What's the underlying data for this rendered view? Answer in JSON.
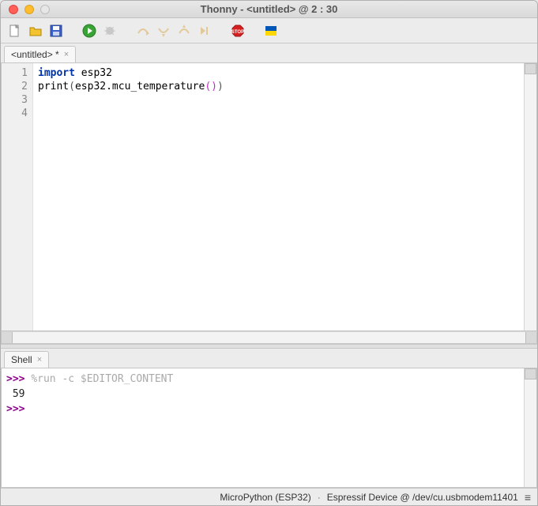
{
  "window": {
    "title": "Thonny  -  <untitled>  @  2 : 30"
  },
  "traffic": {
    "close": "close",
    "minimize": "minimize",
    "zoom": "zoom"
  },
  "toolbar": {
    "new": "new-file-icon",
    "open": "open-file-icon",
    "save": "save-icon",
    "run": "run-icon",
    "debug": "debug-icon",
    "step_over": "step-over-icon",
    "step_into": "step-into-icon",
    "step_out": "step-out-icon",
    "resume": "resume-icon",
    "stop": "stop-icon",
    "flag": "flag-icon"
  },
  "editor": {
    "tab_label": "<untitled> *",
    "line_numbers": [
      "1",
      "2",
      "3",
      "4"
    ],
    "lines": [
      {
        "tokens": [
          {
            "t": "import",
            "c": "kw"
          },
          {
            "t": " esp32",
            "c": "fn"
          }
        ]
      },
      {
        "tokens": [
          {
            "t": "print",
            "c": "fn"
          },
          {
            "t": "(",
            "c": "paren1"
          },
          {
            "t": "esp32.mcu_temperature",
            "c": "fn"
          },
          {
            "t": "(",
            "c": "paren2"
          },
          {
            "t": ")",
            "c": "paren2"
          },
          {
            "t": ")",
            "c": "paren1"
          }
        ]
      },
      {
        "tokens": []
      },
      {
        "tokens": []
      }
    ]
  },
  "shell": {
    "tab_label": "Shell",
    "lines": [
      {
        "prompt": ">>> ",
        "magic": "%run -c $EDITOR_CONTENT"
      },
      {
        "indent": " ",
        "out": "59"
      },
      {
        "prompt": ">>> "
      }
    ]
  },
  "status": {
    "interpreter": "MicroPython (ESP32)",
    "device": "Espressif Device @ /dev/cu.usbmodem11401",
    "separator": "·"
  }
}
